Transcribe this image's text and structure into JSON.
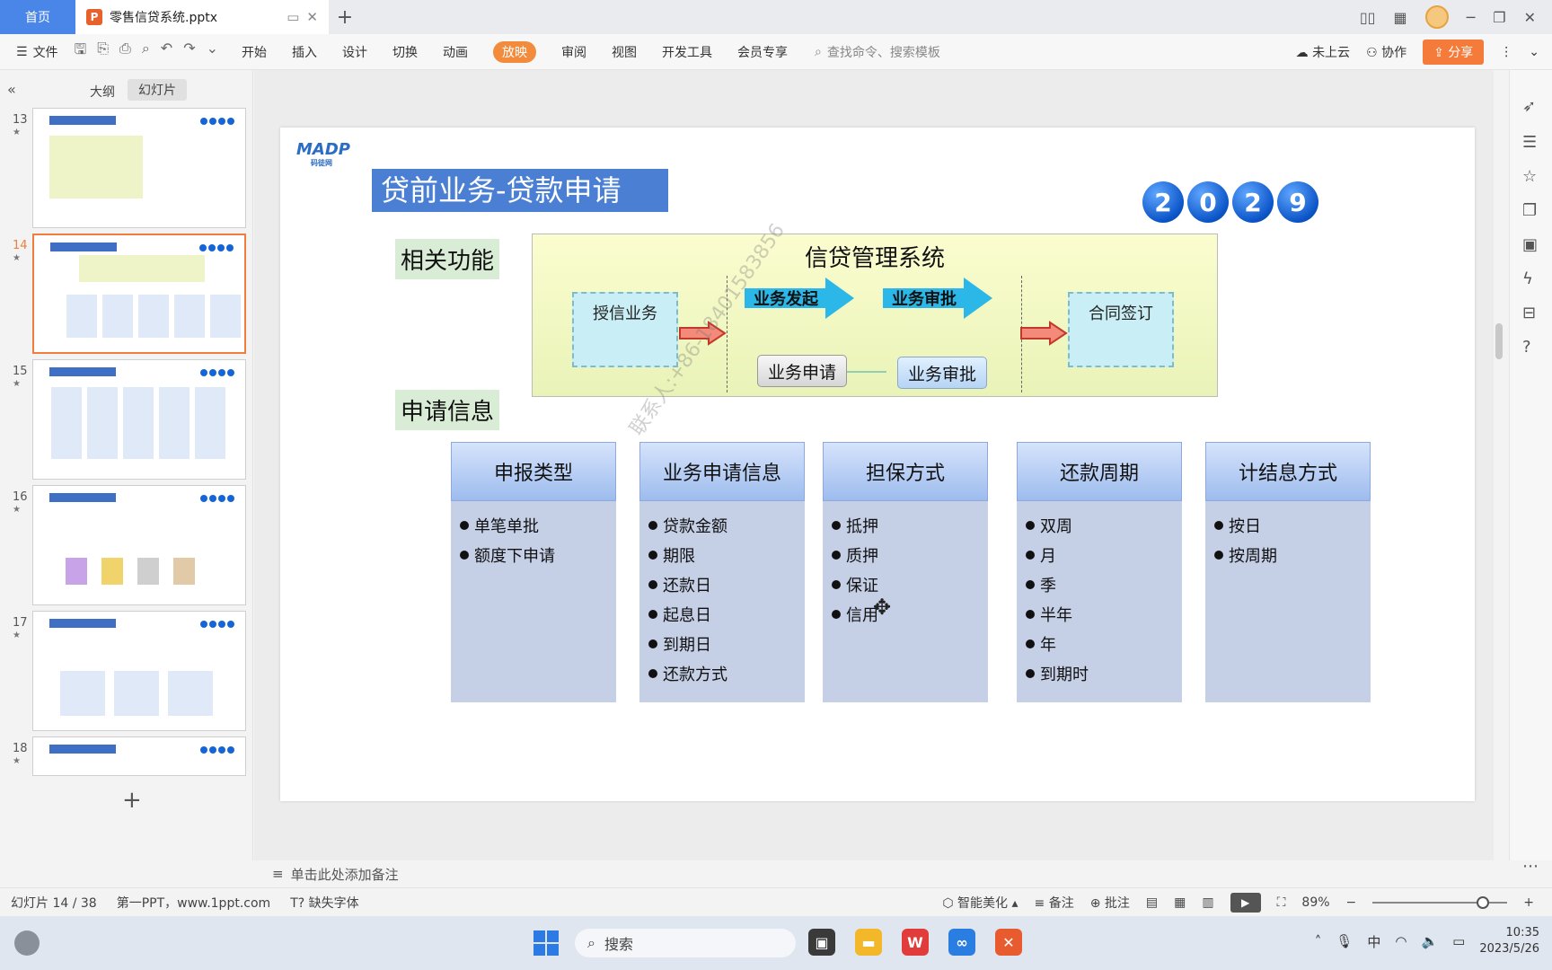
{
  "titlebar": {
    "home_tab": "首页",
    "doc_tab": "零售信贷系统.pptx"
  },
  "ribbon": {
    "file_menu": "文件",
    "tabs": [
      "开始",
      "插入",
      "设计",
      "切换",
      "动画",
      "放映",
      "审阅",
      "视图",
      "开发工具",
      "会员专享"
    ],
    "active_tab": "放映",
    "search_placeholder": "查找命令、搜索模板",
    "cloud": "未上云",
    "collab": "协作",
    "share": "分享"
  },
  "left_panel": {
    "outline_tab": "大纲",
    "slides_tab": "幻灯片",
    "thumbnails": [
      {
        "num": "13"
      },
      {
        "num": "14",
        "selected": true
      },
      {
        "num": "15"
      },
      {
        "num": "16"
      },
      {
        "num": "17"
      },
      {
        "num": "18"
      }
    ]
  },
  "slide": {
    "title": "贷前业务-贷款申请",
    "year_digits": [
      "2",
      "0",
      "2",
      "9"
    ],
    "section1": "相关功能",
    "system_title": "信贷管理系统",
    "credit_business": "授信业务",
    "initiate": "业务发起",
    "approve_header": "业务审批",
    "apply_btn": "业务申请",
    "approve_btn": "业务审批",
    "contract": "合同签订",
    "section2": "申请信息",
    "columns": [
      {
        "header": "申报类型",
        "items": [
          "单笔单批",
          "额度下申请"
        ]
      },
      {
        "header": "业务申请信息",
        "items": [
          "贷款金额",
          "期限",
          "还款日",
          "起息日",
          "到期日",
          "还款方式"
        ]
      },
      {
        "header": "担保方式",
        "items": [
          "抵押",
          "质押",
          "保证",
          "信用"
        ]
      },
      {
        "header": "还款周期",
        "items": [
          "双周",
          "月",
          "季",
          "半年",
          "年",
          "到期时"
        ]
      },
      {
        "header": "计结息方式",
        "items": [
          "按日",
          "按周期"
        ]
      }
    ],
    "watermark": "联系人:+86-18401583856"
  },
  "notes_placeholder": "单击此处添加备注",
  "status": {
    "slide_counter": "幻灯片 14 / 38",
    "theme": "第一PPT，www.1ppt.com",
    "missing_font": "缺失字体",
    "beautify": "智能美化",
    "notes": "备注",
    "comments": "批注",
    "zoom": "89%"
  },
  "taskbar": {
    "search": "搜索",
    "ime": "中",
    "time": "10:35",
    "date": "2023/5/26"
  },
  "colors": {
    "accent": "#f28b3c",
    "title_blue": "#4a7fd4",
    "ball_blue": "#0b55c8"
  }
}
